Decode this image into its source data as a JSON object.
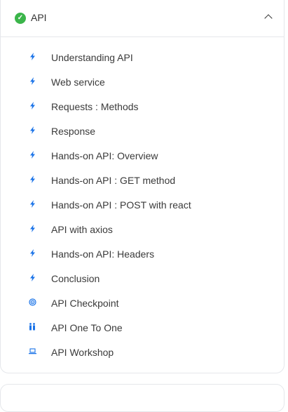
{
  "section": {
    "title": "API",
    "status_icon": "check-circle-icon",
    "status_color": "#3bb54a",
    "expanded": true,
    "items": [
      {
        "label": "Understanding API",
        "icon": "lightning-icon"
      },
      {
        "label": "Web service",
        "icon": "lightning-icon"
      },
      {
        "label": "Requests : Methods",
        "icon": "lightning-icon"
      },
      {
        "label": "Response",
        "icon": "lightning-icon"
      },
      {
        "label": "Hands-on API: Overview",
        "icon": "lightning-icon"
      },
      {
        "label": "Hands-on API : GET method",
        "icon": "lightning-icon"
      },
      {
        "label": "Hands-on API : POST with react",
        "icon": "lightning-icon"
      },
      {
        "label": "API with axios",
        "icon": "lightning-icon"
      },
      {
        "label": "Hands-on API: Headers",
        "icon": "lightning-icon"
      },
      {
        "label": "Conclusion",
        "icon": "lightning-icon"
      },
      {
        "label": "API Checkpoint",
        "icon": "target-icon"
      },
      {
        "label": "API One To One",
        "icon": "people-icon"
      },
      {
        "label": "API Workshop",
        "icon": "laptop-icon"
      }
    ]
  },
  "accent": "#1a73e8"
}
